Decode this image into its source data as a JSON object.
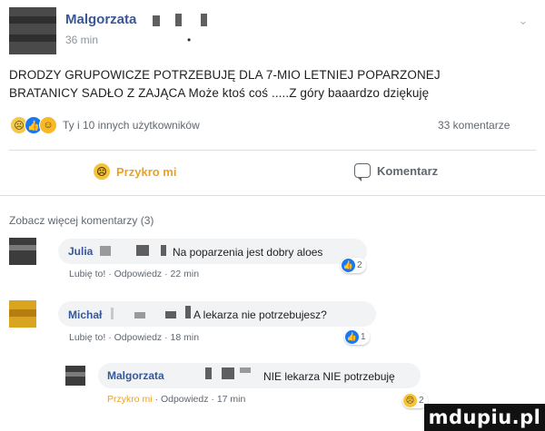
{
  "post": {
    "author": "Malgorzata",
    "time": "36 min",
    "dot": "•",
    "text_lines": [
      "DRODZY GRUPOWICZE POTRZEBUJĘ DLA 7-MIO LETNIEJ POPARZONEJ",
      "BRATANICY SADŁO Z ZAJĄCA Może ktoś coś .....Z góry baaardzo dziękuję"
    ]
  },
  "reactions": {
    "summary": "Ty i 10 innych użytkowników",
    "comments_count": "33 komentarze"
  },
  "actions": {
    "sorry_label": "Przykro mi",
    "comment_label": "Komentarz"
  },
  "more_comments": "Zobacz więcej komentarzy (3)",
  "comments": [
    {
      "name": "Julia",
      "text": "Na poparzenia jest dobry aloes",
      "like": "Lubię to!",
      "reply": "Odpowiedz",
      "time": "22 min",
      "reaction_count": "2"
    },
    {
      "name": "Michał",
      "text": "A lekarza nie potrzebujesz?",
      "like": "Lubię to!",
      "reply": "Odpowiedz",
      "time": "18 min",
      "reaction_count": "1"
    },
    {
      "name": "Malgorzata",
      "text": "NIE lekarza NIE potrzebuję",
      "like": "Przykro mi",
      "reply": "Odpowiedz",
      "time": "17 min",
      "reaction_count": "2"
    }
  ],
  "icons": {
    "sad": "sad-reaction-icon",
    "like": "like-reaction-icon",
    "wow": "wow-reaction-icon",
    "comment": "comment-bubble-icon",
    "chevron": "chevron-down-icon"
  },
  "colors": {
    "name_link": "#365899",
    "sorry_accent": "#e8a32a",
    "like_blue": "#1877f2"
  },
  "watermark": "mdupiu.pl"
}
